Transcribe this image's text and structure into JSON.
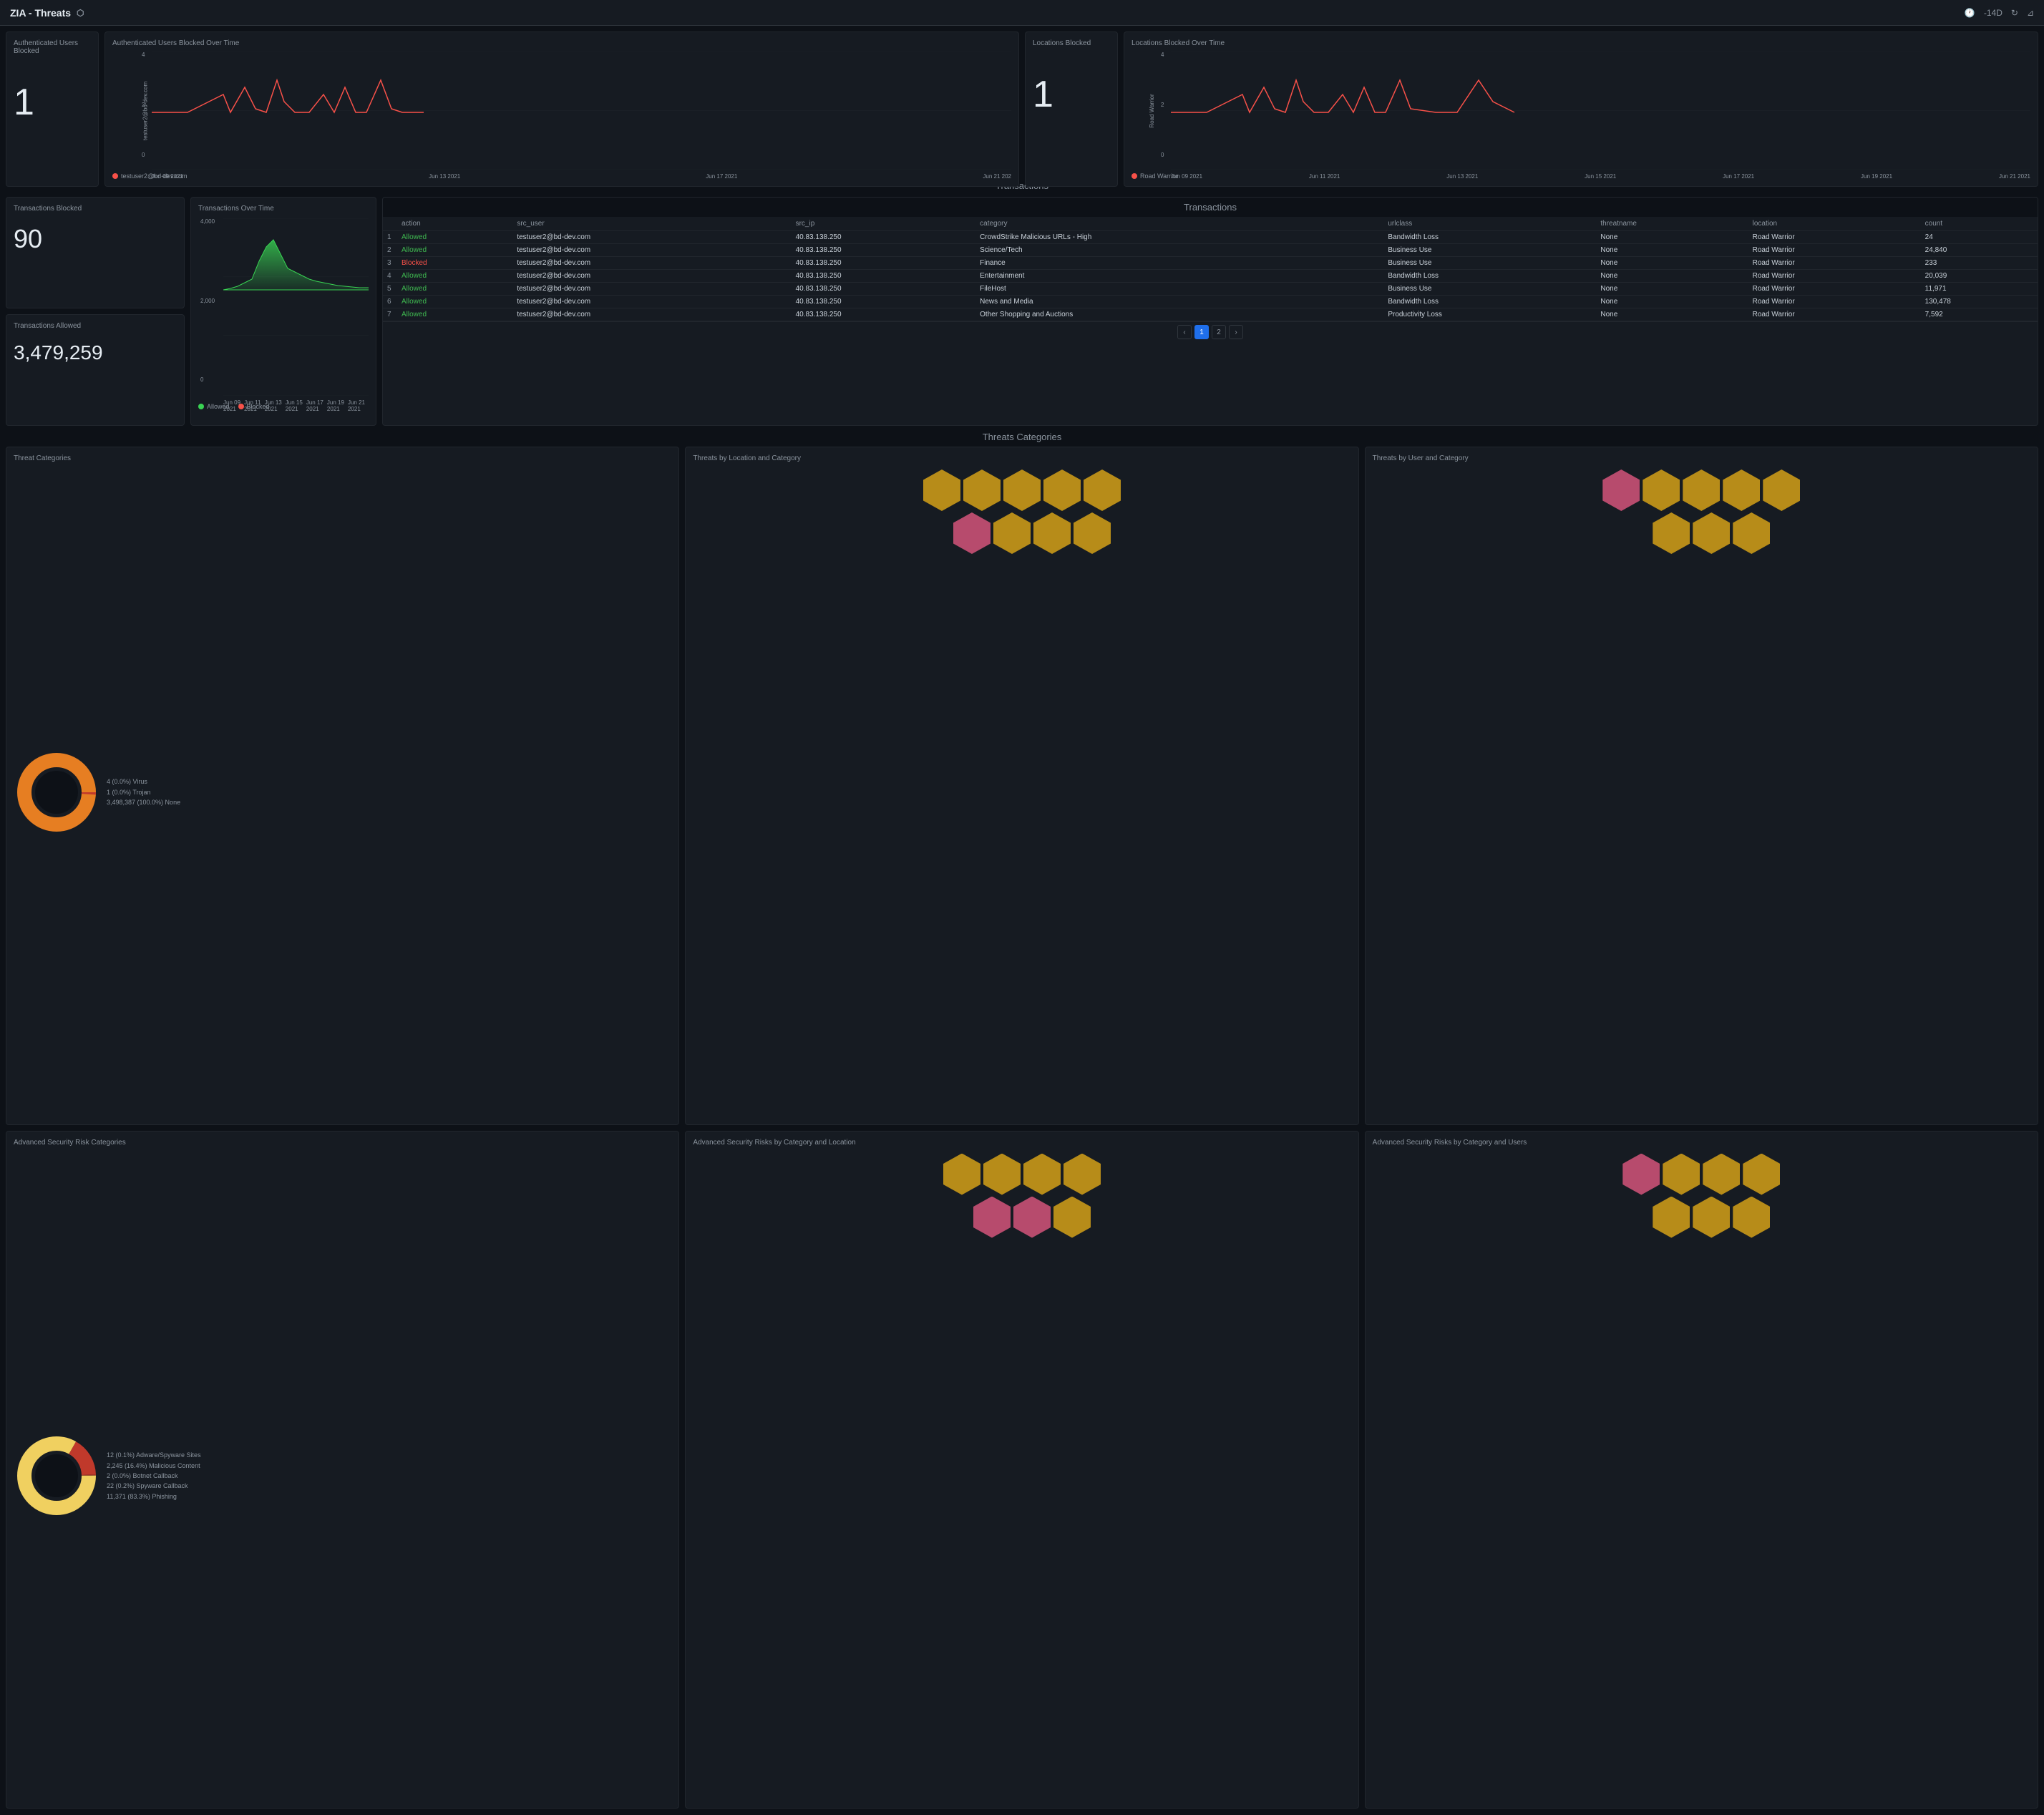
{
  "header": {
    "title": "ZIA - Threats",
    "timeRange": "-14D",
    "refreshIcon": "↻",
    "filterIcon": "⊿"
  },
  "topRow": {
    "authUsersBlocked": {
      "title": "Authenticated Users Blocked",
      "value": "1",
      "chartTitle": "Authenticated Users Blocked Over Time",
      "yLabels": [
        "4",
        "",
        "2",
        "",
        "0"
      ],
      "xLabels": [
        "Jun 09 2021",
        "Jun 13 2021",
        "Jun 17 2021",
        "Jun 21 202"
      ],
      "yAxisLabel": "testuser2@bd-dev.com",
      "legend": "testuser2@bd-dev.com",
      "legendColor": "#f85149"
    },
    "locationsBlocked": {
      "title": "Locations Blocked",
      "value": "1",
      "chartTitle": "Locations Blocked Over Time",
      "yLabels": [
        "4",
        "",
        "2",
        "",
        "0"
      ],
      "xLabels": [
        "Jun 09 2021",
        "Jun 11 2021",
        "Jun 13 2021",
        "Jun 15 2021",
        "Jun 17 2021",
        "Jun 19 2021",
        "Jun 21 2021"
      ],
      "yAxisLabel": "Road Warrior",
      "legend": "Road Warrior",
      "legendColor": "#f85149"
    }
  },
  "middleSection": {
    "sectionTitle": "Transactions",
    "transactionsBlocked": {
      "title": "Transactions Blocked",
      "value": "90"
    },
    "transactionsAllowed": {
      "title": "Transactions Allowed",
      "value": "3,479,259"
    },
    "transactionsOverTime": {
      "title": "Transactions Over Time",
      "yLabels": [
        "4,000",
        "",
        "2,000",
        "",
        "0"
      ],
      "xLabels": [
        "Jun 09 2021",
        "Jun 11 2021",
        "Jun 13 2021",
        "Jun 15 2021",
        "Jun 17 2021",
        "Jun 19 2021",
        "Jun 21 2021"
      ],
      "legendAllowed": "Allowed",
      "legendBlocked": "Blocked"
    },
    "table": {
      "title": "Transactions",
      "columns": [
        "",
        "action",
        "src_user",
        "src_ip",
        "category",
        "urlclass",
        "threatname",
        "location",
        "count"
      ],
      "rows": [
        {
          "num": 1,
          "action": "Allowed",
          "src_user": "testuser2@bd-dev.com",
          "src_ip": "40.83.138.250",
          "category": "CrowdStrike Malicious URLs - High",
          "urlclass": "Bandwidth Loss",
          "threatname": "None",
          "location": "Road Warrior",
          "count": "24"
        },
        {
          "num": 2,
          "action": "Allowed",
          "src_user": "testuser2@bd-dev.com",
          "src_ip": "40.83.138.250",
          "category": "Science/Tech",
          "urlclass": "Business Use",
          "threatname": "None",
          "location": "Road Warrior",
          "count": "24,840"
        },
        {
          "num": 3,
          "action": "Blocked",
          "src_user": "testuser2@bd-dev.com",
          "src_ip": "40.83.138.250",
          "category": "Finance",
          "urlclass": "Business Use",
          "threatname": "None",
          "location": "Road Warrior",
          "count": "233"
        },
        {
          "num": 4,
          "action": "Allowed",
          "src_user": "testuser2@bd-dev.com",
          "src_ip": "40.83.138.250",
          "category": "Entertainment",
          "urlclass": "Bandwidth Loss",
          "threatname": "None",
          "location": "Road Warrior",
          "count": "20,039"
        },
        {
          "num": 5,
          "action": "Allowed",
          "src_user": "testuser2@bd-dev.com",
          "src_ip": "40.83.138.250",
          "category": "FileHost",
          "urlclass": "Business Use",
          "threatname": "None",
          "location": "Road Warrior",
          "count": "11,971"
        },
        {
          "num": 6,
          "action": "Allowed",
          "src_user": "testuser2@bd-dev.com",
          "src_ip": "40.83.138.250",
          "category": "News and Media",
          "urlclass": "Bandwidth Loss",
          "threatname": "None",
          "location": "Road Warrior",
          "count": "130,478"
        },
        {
          "num": 7,
          "action": "Allowed",
          "src_user": "testuser2@bd-dev.com",
          "src_ip": "40.83.138.250",
          "category": "Other Shopping and Auctions",
          "urlclass": "Productivity Loss",
          "threatname": "None",
          "location": "Road Warrior",
          "count": "7,592"
        }
      ],
      "pagination": {
        "prev": "‹",
        "pages": [
          "1",
          "2"
        ],
        "next": "›",
        "activePage": "1"
      }
    }
  },
  "bottomSection": {
    "title": "Threats Categories",
    "threatCategories": {
      "title": "Threat Categories",
      "segments": [
        {
          "label": "4 (0.0%) Virus",
          "color": "#c0392b",
          "pct": 0.1
        },
        {
          "label": "1 (0.0%) Trojan",
          "color": "#c0392b",
          "pct": 0.0
        },
        {
          "label": "3,498,387 (100.0%) None",
          "color": "#e67e22",
          "pct": 99.9
        }
      ]
    },
    "threatsByLocation": {
      "title": "Threats by Location and Category",
      "hexRows": [
        [
          "yellow",
          "yellow",
          "yellow",
          "yellow",
          "yellow"
        ],
        [
          "pink",
          "yellow",
          "yellow",
          "yellow"
        ]
      ]
    },
    "threatsByUser": {
      "title": "Threats by User and Category",
      "hexRows": [
        [
          "pink",
          "yellow",
          "yellow",
          "yellow",
          "yellow"
        ],
        [
          "yellow",
          "yellow",
          "yellow"
        ]
      ]
    },
    "advancedSecurityRisk": {
      "title": "Advanced Security Risk Categories",
      "segments": [
        {
          "label": "12 (0.1%) Adware/Spyware Sites",
          "color": "#f0d060",
          "pct": 0.1
        },
        {
          "label": "2,245 (16.4%) Malicious Content",
          "color": "#c0392b",
          "pct": 16.4
        },
        {
          "label": "2 (0.0%) Botnet Callback",
          "color": "#c0392b",
          "pct": 0.0
        },
        {
          "label": "22 (0.2%) Spyware Callback",
          "color": "#c0392b",
          "pct": 0.2
        },
        {
          "label": "11,371 (83.3%) Phishing",
          "color": "#f0d060",
          "pct": 83.3
        }
      ]
    },
    "advancedByLocation": {
      "title": "Advanced Security Risks by Category and Location",
      "hexRows": [
        [
          "yellow",
          "yellow",
          "yellow",
          "yellow"
        ],
        [
          "pink",
          "pink",
          "yellow"
        ]
      ]
    },
    "advancedByUsers": {
      "title": "Advanced Security Risks by Category and Users",
      "hexRows": [
        [
          "pink",
          "yellow",
          "yellow",
          "yellow"
        ],
        [
          "yellow",
          "yellow",
          "yellow"
        ]
      ]
    }
  }
}
